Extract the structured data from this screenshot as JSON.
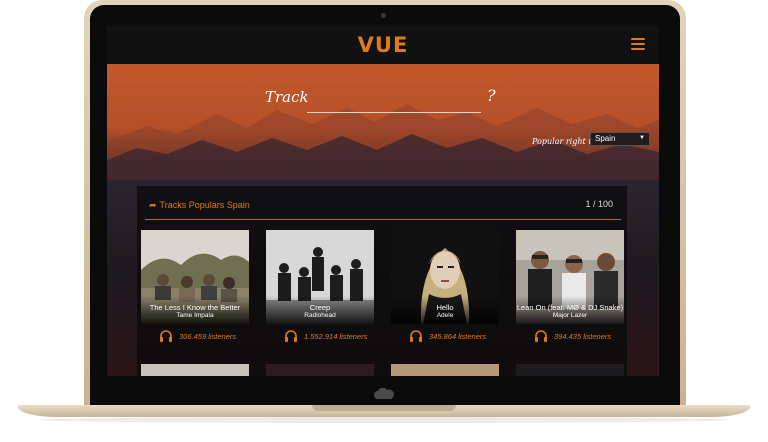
{
  "app": {
    "logo": "VUE",
    "menu_icon": "hamburger-icon"
  },
  "search": {
    "label": "Track",
    "value": "",
    "suffix": "?"
  },
  "popular": {
    "label": "Popular right now",
    "selected_country": "Spain"
  },
  "tracks_panel": {
    "title": "Tracks Populars Spain",
    "page_indicator": "1 / 100"
  },
  "tracks": [
    {
      "title": "The Less I Know the Better",
      "artist": "Tame Impala",
      "listeners": "306.459 listeners"
    },
    {
      "title": "Creep",
      "artist": "Radiohead",
      "listeners": "1.552.914 listeners"
    },
    {
      "title": "Hello",
      "artist": "Adele",
      "listeners": "345.864 listeners"
    },
    {
      "title": "Lean On (feat. MØ & DJ Snake)",
      "artist": "Major Lazer",
      "listeners": "394.435 listeners"
    }
  ],
  "colors": {
    "accent": "#e07a1c",
    "hero": "#b5502a",
    "background": "#151214"
  }
}
